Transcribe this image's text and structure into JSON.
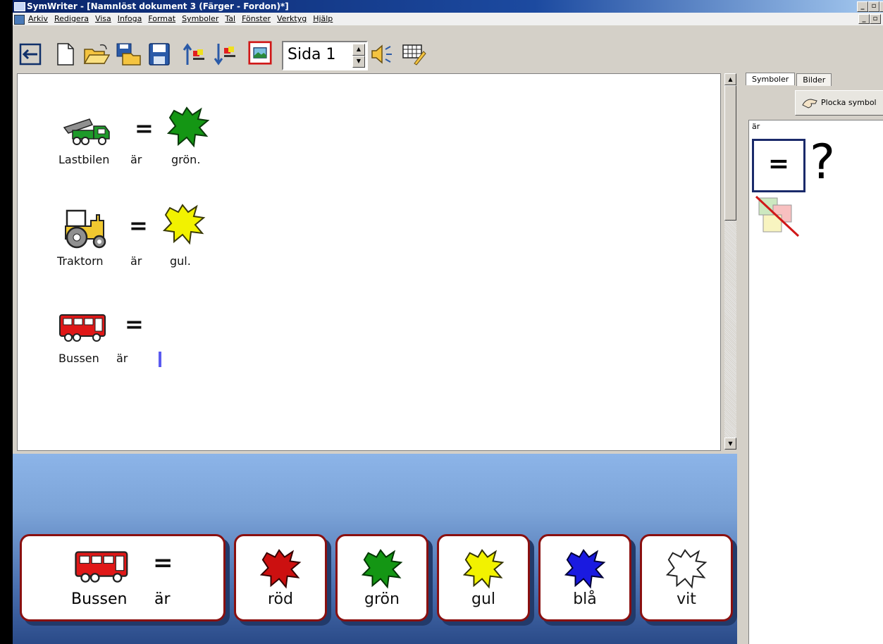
{
  "window": {
    "title": "SymWriter - [Namnlöst dokument 3 (Färger - Fordon)*]",
    "controls": [
      "_",
      "▫",
      "×"
    ]
  },
  "menu": [
    "Arkiv",
    "Redigera",
    "Visa",
    "Infoga",
    "Format",
    "Symboler",
    "Tal",
    "Fönster",
    "Verktyg",
    "Hjälp"
  ],
  "toolbar": {
    "page_label": "Sida 1"
  },
  "document": {
    "lines": [
      {
        "words": [
          "Lastbilen",
          "är",
          "grön."
        ]
      },
      {
        "words": [
          "Traktorn",
          "är",
          "gul."
        ]
      },
      {
        "words": [
          "Bussen",
          "är"
        ]
      }
    ],
    "eq_symbol": "="
  },
  "grid": {
    "first_card": {
      "word1": "Bussen",
      "word2": "är",
      "eq": "="
    },
    "cards": [
      {
        "label": "röd",
        "color": "#cc1010"
      },
      {
        "label": "grön",
        "color": "#149614"
      },
      {
        "label": "gul",
        "color": "#f2f200"
      },
      {
        "label": "blå",
        "color": "#1a1ae0"
      },
      {
        "label": "vit",
        "color": "#ffffff"
      }
    ]
  },
  "panel": {
    "tabs": [
      "Symboler",
      "Bilder"
    ],
    "pick_button": "Plocka symbol",
    "current_word": "är",
    "eq_symbol": "=",
    "question": "?"
  }
}
